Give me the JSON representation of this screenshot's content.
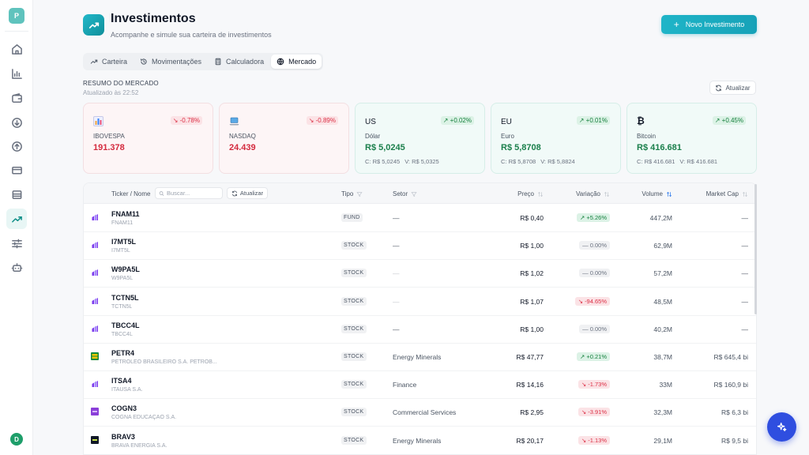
{
  "sidebar": {
    "workspace_initial": "P",
    "user_initial": "D",
    "items": [
      "home-icon",
      "bar-chart-icon",
      "wallet-icon",
      "arrow-down-circle-icon",
      "arrow-up-circle-icon",
      "credit-card-icon",
      "archive-icon",
      "trending-up-icon",
      "sliders-icon",
      "bot-icon"
    ],
    "active_item": "trending-up-icon"
  },
  "header": {
    "title": "Investimentos",
    "subtitle": "Acompanhe e simule sua carteira de investimentos",
    "new_button": "Novo Investimento"
  },
  "tabs": [
    {
      "label": "Carteira",
      "icon": "trending-up-icon"
    },
    {
      "label": "Movimentações",
      "icon": "history-icon"
    },
    {
      "label": "Calculadora",
      "icon": "calculator-icon"
    },
    {
      "label": "Mercado",
      "icon": "globe-icon",
      "active": true
    }
  ],
  "market": {
    "title": "RESUMO DO MERCADO",
    "updated": "Atualizado às 22:52",
    "refresh_label": "Atualizar",
    "cards": [
      {
        "name": "IBOVESPA",
        "value": "191.378",
        "change": "-0.78%",
        "trend": "down",
        "icon": "bar-chart-emoji"
      },
      {
        "name": "NASDAQ",
        "value": "24.439",
        "change": "-0.89%",
        "trend": "down",
        "icon": "laptop-emoji"
      },
      {
        "code": "US",
        "name": "Dólar",
        "value": "R$ 5,0245",
        "change": "+0.02%",
        "trend": "up",
        "bid": "C: R$ 5,0245",
        "ask": "V: R$ 5,0325"
      },
      {
        "code": "EU",
        "name": "Euro",
        "value": "R$ 5,8708",
        "change": "+0.01%",
        "trend": "up",
        "bid": "C: R$ 5,8708",
        "ask": "V: R$ 5,8824"
      },
      {
        "code": "₿",
        "name": "Bitcoin",
        "value": "R$ 416.681",
        "change": "+0.45%",
        "trend": "up",
        "bid": "C: R$ 416.681",
        "ask": "V: R$ 416.681"
      }
    ]
  },
  "table": {
    "headers": {
      "ticker": "Ticker / Nome",
      "tipo": "Tipo",
      "setor": "Setor",
      "preco": "Preço",
      "variacao": "Variação",
      "volume": "Volume",
      "market_cap": "Market Cap"
    },
    "search_placeholder": "Buscar...",
    "refresh_label": "Atualizar",
    "rows": [
      {
        "ticker": "FNAM11",
        "name": "FNAM11",
        "tipo": "FUND",
        "setor": "—",
        "setor_muted": false,
        "preco": "R$ 0,40",
        "variacao": "+5.26%",
        "trend": "up",
        "volume": "447,2M",
        "market_cap": "—",
        "logo": "purple"
      },
      {
        "ticker": "I7MT5L",
        "name": "I7MT5L",
        "tipo": "STOCK",
        "setor": "—",
        "setor_muted": false,
        "preco": "R$ 1,00",
        "variacao": "0.00%",
        "trend": "flat",
        "volume": "62,9M",
        "market_cap": "—",
        "logo": "purple"
      },
      {
        "ticker": "W9PA5L",
        "name": "W9PA5L",
        "tipo": "STOCK",
        "setor": "—",
        "setor_muted": true,
        "preco": "R$ 1,02",
        "variacao": "0.00%",
        "trend": "flat",
        "volume": "57,2M",
        "market_cap": "—",
        "logo": "purple"
      },
      {
        "ticker": "TCTN5L",
        "name": "TCTN5L",
        "tipo": "STOCK",
        "setor": "—",
        "setor_muted": true,
        "preco": "R$ 1,07",
        "variacao": "-94.65%",
        "trend": "down",
        "volume": "48,5M",
        "market_cap": "—",
        "logo": "purple"
      },
      {
        "ticker": "TBCC4L",
        "name": "TBCC4L",
        "tipo": "STOCK",
        "setor": "—",
        "setor_muted": false,
        "preco": "R$ 1,00",
        "variacao": "0.00%",
        "trend": "flat",
        "volume": "40,2M",
        "market_cap": "—",
        "logo": "purple"
      },
      {
        "ticker": "PETR4",
        "name": "PETROLEO BRASILEIRO S.A. PETROB...",
        "tipo": "STOCK",
        "setor": "Energy Minerals",
        "setor_muted": false,
        "preco": "R$ 47,77",
        "variacao": "+0.21%",
        "trend": "up",
        "volume": "38,7M",
        "market_cap": "R$ 645,4 bi",
        "logo": "petrobras"
      },
      {
        "ticker": "ITSA4",
        "name": "ITAUSA S.A.",
        "tipo": "STOCK",
        "setor": "Finance",
        "setor_muted": false,
        "preco": "R$ 14,16",
        "variacao": "-1.73%",
        "trend": "down",
        "volume": "33M",
        "market_cap": "R$ 160,9 bi",
        "logo": "purple"
      },
      {
        "ticker": "COGN3",
        "name": "COGNA EDUCAÇÃO S.A.",
        "tipo": "STOCK",
        "setor": "Commercial Services",
        "setor_muted": false,
        "preco": "R$ 2,95",
        "variacao": "-3.91%",
        "trend": "down",
        "volume": "32,3M",
        "market_cap": "R$ 6,3 bi",
        "logo": "cogna"
      },
      {
        "ticker": "BRAV3",
        "name": "BRAVA ENERGIA S.A.",
        "tipo": "STOCK",
        "setor": "Energy Minerals",
        "setor_muted": false,
        "preco": "R$ 20,17",
        "variacao": "-1.13%",
        "trend": "down",
        "volume": "29,1M",
        "market_cap": "R$ 9,5 bi",
        "logo": "brava"
      }
    ]
  },
  "colors": {
    "accent": "#17a2b8",
    "positive": "#15803d",
    "negative": "#dc2f45",
    "fab": "#2f4ee0"
  }
}
